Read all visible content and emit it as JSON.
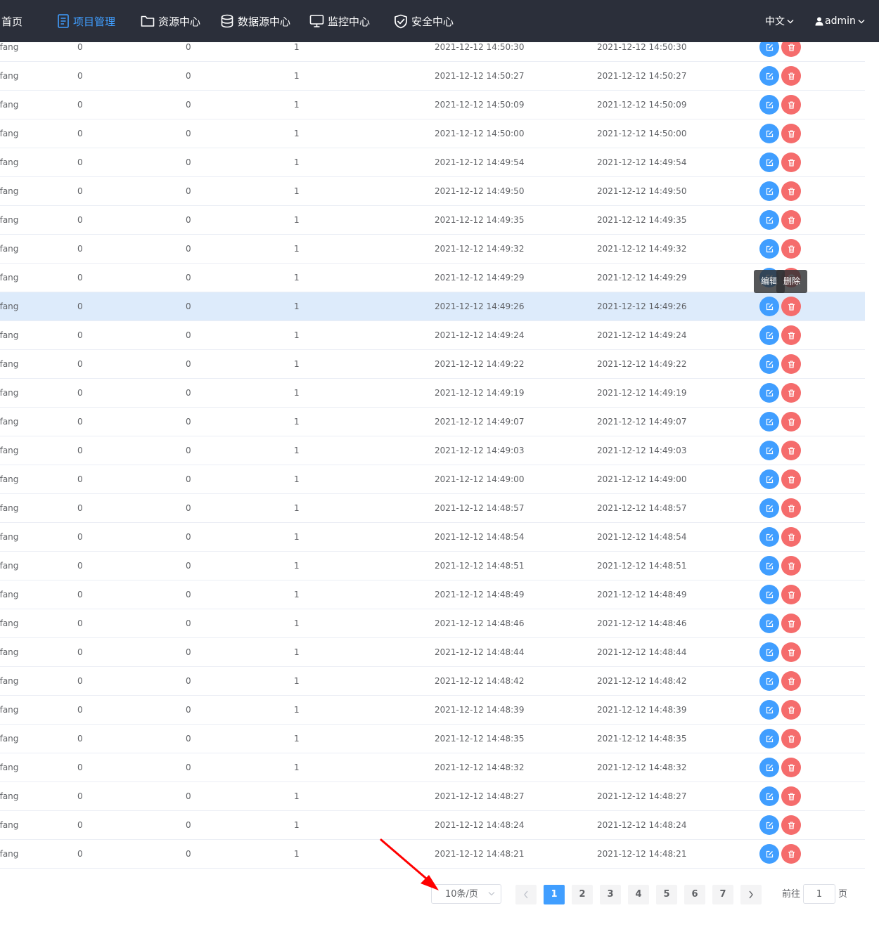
{
  "nav": {
    "home": "首页",
    "items": [
      {
        "label": "项目管理",
        "icon": "document-list-icon",
        "active": true
      },
      {
        "label": "资源中心",
        "icon": "folder-icon",
        "active": false
      },
      {
        "label": "数据源中心",
        "icon": "database-icon",
        "active": false
      },
      {
        "label": "监控中心",
        "icon": "monitor-icon",
        "active": false
      },
      {
        "label": "安全中心",
        "icon": "shield-check-icon",
        "active": false
      }
    ],
    "language": "中文",
    "user": "admin"
  },
  "table": {
    "rows": [
      {
        "name": "nfang",
        "a": "0",
        "b": "0",
        "c": "1",
        "created": "2021-12-12 14:50:30",
        "updated": "2021-12-12 14:50:30"
      },
      {
        "name": "nfang",
        "a": "0",
        "b": "0",
        "c": "1",
        "created": "2021-12-12 14:50:27",
        "updated": "2021-12-12 14:50:27"
      },
      {
        "name": "nfang",
        "a": "0",
        "b": "0",
        "c": "1",
        "created": "2021-12-12 14:50:09",
        "updated": "2021-12-12 14:50:09"
      },
      {
        "name": "nfang",
        "a": "0",
        "b": "0",
        "c": "1",
        "created": "2021-12-12 14:50:00",
        "updated": "2021-12-12 14:50:00"
      },
      {
        "name": "nfang",
        "a": "0",
        "b": "0",
        "c": "1",
        "created": "2021-12-12 14:49:54",
        "updated": "2021-12-12 14:49:54"
      },
      {
        "name": "nfang",
        "a": "0",
        "b": "0",
        "c": "1",
        "created": "2021-12-12 14:49:50",
        "updated": "2021-12-12 14:49:50"
      },
      {
        "name": "nfang",
        "a": "0",
        "b": "0",
        "c": "1",
        "created": "2021-12-12 14:49:35",
        "updated": "2021-12-12 14:49:35"
      },
      {
        "name": "nfang",
        "a": "0",
        "b": "0",
        "c": "1",
        "created": "2021-12-12 14:49:32",
        "updated": "2021-12-12 14:49:32"
      },
      {
        "name": "nfang",
        "a": "0",
        "b": "0",
        "c": "1",
        "created": "2021-12-12 14:49:29",
        "updated": "2021-12-12 14:49:29"
      },
      {
        "name": "nfang",
        "a": "0",
        "b": "0",
        "c": "1",
        "created": "2021-12-12 14:49:26",
        "updated": "2021-12-12 14:49:26",
        "hovered": true
      },
      {
        "name": "nfang",
        "a": "0",
        "b": "0",
        "c": "1",
        "created": "2021-12-12 14:49:24",
        "updated": "2021-12-12 14:49:24"
      },
      {
        "name": "nfang",
        "a": "0",
        "b": "0",
        "c": "1",
        "created": "2021-12-12 14:49:22",
        "updated": "2021-12-12 14:49:22"
      },
      {
        "name": "nfang",
        "a": "0",
        "b": "0",
        "c": "1",
        "created": "2021-12-12 14:49:19",
        "updated": "2021-12-12 14:49:19"
      },
      {
        "name": "nfang",
        "a": "0",
        "b": "0",
        "c": "1",
        "created": "2021-12-12 14:49:07",
        "updated": "2021-12-12 14:49:07"
      },
      {
        "name": "nfang",
        "a": "0",
        "b": "0",
        "c": "1",
        "created": "2021-12-12 14:49:03",
        "updated": "2021-12-12 14:49:03"
      },
      {
        "name": "nfang",
        "a": "0",
        "b": "0",
        "c": "1",
        "created": "2021-12-12 14:49:00",
        "updated": "2021-12-12 14:49:00"
      },
      {
        "name": "nfang",
        "a": "0",
        "b": "0",
        "c": "1",
        "created": "2021-12-12 14:48:57",
        "updated": "2021-12-12 14:48:57"
      },
      {
        "name": "nfang",
        "a": "0",
        "b": "0",
        "c": "1",
        "created": "2021-12-12 14:48:54",
        "updated": "2021-12-12 14:48:54"
      },
      {
        "name": "nfang",
        "a": "0",
        "b": "0",
        "c": "1",
        "created": "2021-12-12 14:48:51",
        "updated": "2021-12-12 14:48:51"
      },
      {
        "name": "nfang",
        "a": "0",
        "b": "0",
        "c": "1",
        "created": "2021-12-12 14:48:49",
        "updated": "2021-12-12 14:48:49"
      },
      {
        "name": "nfang",
        "a": "0",
        "b": "0",
        "c": "1",
        "created": "2021-12-12 14:48:46",
        "updated": "2021-12-12 14:48:46"
      },
      {
        "name": "nfang",
        "a": "0",
        "b": "0",
        "c": "1",
        "created": "2021-12-12 14:48:44",
        "updated": "2021-12-12 14:48:44"
      },
      {
        "name": "nfang",
        "a": "0",
        "b": "0",
        "c": "1",
        "created": "2021-12-12 14:48:42",
        "updated": "2021-12-12 14:48:42"
      },
      {
        "name": "nfang",
        "a": "0",
        "b": "0",
        "c": "1",
        "created": "2021-12-12 14:48:39",
        "updated": "2021-12-12 14:48:39"
      },
      {
        "name": "nfang",
        "a": "0",
        "b": "0",
        "c": "1",
        "created": "2021-12-12 14:48:35",
        "updated": "2021-12-12 14:48:35"
      },
      {
        "name": "nfang",
        "a": "0",
        "b": "0",
        "c": "1",
        "created": "2021-12-12 14:48:32",
        "updated": "2021-12-12 14:48:32"
      },
      {
        "name": "nfang",
        "a": "0",
        "b": "0",
        "c": "1",
        "created": "2021-12-12 14:48:27",
        "updated": "2021-12-12 14:48:27"
      },
      {
        "name": "nfang",
        "a": "0",
        "b": "0",
        "c": "1",
        "created": "2021-12-12 14:48:24",
        "updated": "2021-12-12 14:48:24"
      },
      {
        "name": "nfang",
        "a": "0",
        "b": "0",
        "c": "1",
        "created": "2021-12-12 14:48:21",
        "updated": "2021-12-12 14:48:21"
      }
    ],
    "tooltips": {
      "edit": "编辑",
      "delete": "删除"
    }
  },
  "pagination": {
    "page_size": "10条/页",
    "pages": [
      "1",
      "2",
      "3",
      "4",
      "5",
      "6",
      "7"
    ],
    "current": "1",
    "prev_icon": "chevron-left-icon",
    "next_icon": "chevron-right-icon",
    "jump_prefix": "前往",
    "jump_value": "1",
    "jump_suffix": "页"
  },
  "colors": {
    "nav_bg": "#2b2f3a",
    "accent": "#409eff",
    "danger": "#f56c6c",
    "hover_row": "#ddebfb",
    "annotation": "#ff0000"
  }
}
